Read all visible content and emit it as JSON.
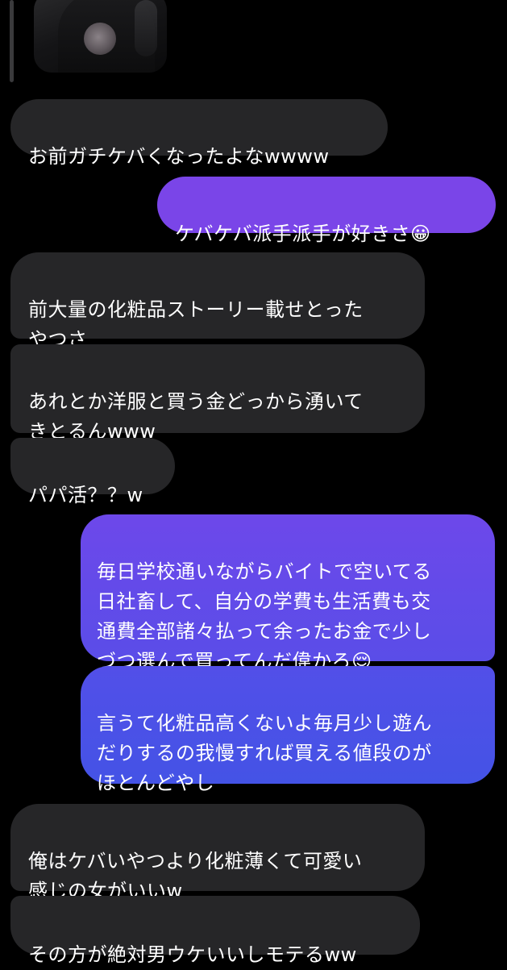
{
  "thread": {
    "story_preview": "story-image",
    "messages": [
      {
        "id": 1,
        "side": "received",
        "text": "お前ガチケバくなったよなwwww"
      },
      {
        "id": 2,
        "side": "sent",
        "text": "ケバケバ派手派手が好きさ😀"
      },
      {
        "id": 3,
        "side": "received",
        "text": "前大量の化粧品ストーリー載せとった\nやつさ"
      },
      {
        "id": 4,
        "side": "received",
        "text": "あれとか洋服と買う金どっから湧いて\nきとるんwww"
      },
      {
        "id": 5,
        "side": "received",
        "text": "パパ活？？w"
      },
      {
        "id": 6,
        "side": "sent",
        "text": "毎日学校通いながらバイトで空いてる\n日社畜して、自分の学費も生活費も交\n通費全部諸々払って余ったお金で少し\nづつ選んで買ってんだ偉かろ😌"
      },
      {
        "id": 7,
        "side": "sent",
        "text": "言うて化粧品高くないよ毎月少し遊ん\nだりするの我慢すれば買える値段のが\nほとんどやし"
      },
      {
        "id": 8,
        "side": "received",
        "text": "俺はケバいやつより化粧薄くて可愛い\n感じの女がいいw"
      },
      {
        "id": 9,
        "side": "received",
        "text": "その方が絶対男ウケいいしモテるww"
      }
    ]
  },
  "colors": {
    "background": "#000000",
    "received_bubble": "#262628",
    "sent_gradient_top": "#7a45e8",
    "sent_gradient_bottom": "#4a52e6",
    "text": "#ffffff"
  }
}
